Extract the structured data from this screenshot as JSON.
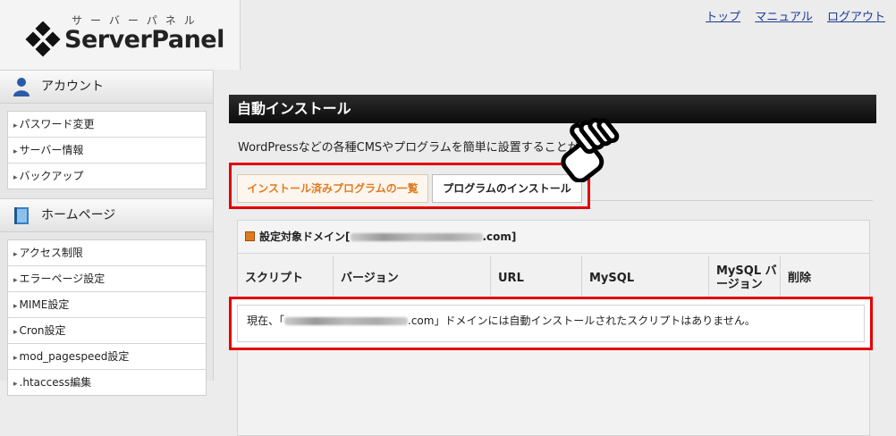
{
  "header": {
    "logo_kana": "サーバーパネル",
    "logo_text": "ServerPanel",
    "nav": [
      "トップ",
      "マニュアル",
      "ログアウト"
    ]
  },
  "sidebar": {
    "sections": [
      {
        "title": "アカウント",
        "icon": "user-icon",
        "items": [
          "パスワード変更",
          "サーバー情報",
          "バックアップ"
        ]
      },
      {
        "title": "ホームページ",
        "icon": "book-icon",
        "items": [
          "アクセス制限",
          "エラーページ設定",
          "MIME設定",
          "Cron設定",
          "mod_pagespeed設定",
          ".htaccess編集"
        ]
      }
    ]
  },
  "main": {
    "title": "自動インストール",
    "description": "WordPressなどの各種CMSやプログラムを簡単に設置することが",
    "tabs": [
      "インストール済みプログラムの一覧",
      "プログラムのインストール"
    ],
    "domain_label_prefix": "設定対象ドメイン[",
    "domain_label_suffix": ".com]",
    "columns": [
      "スクリプト",
      "バージョン",
      "URL",
      "MySQL",
      "MySQL バージョン",
      "削除"
    ],
    "message_prefix": "現在、「",
    "message_suffix": ".com」ドメインには自動インストールされたスクリプトはありません。"
  },
  "colors": {
    "highlight": "#e30000",
    "active_tab_text": "#e07a1e",
    "link": "#1a3d99"
  }
}
